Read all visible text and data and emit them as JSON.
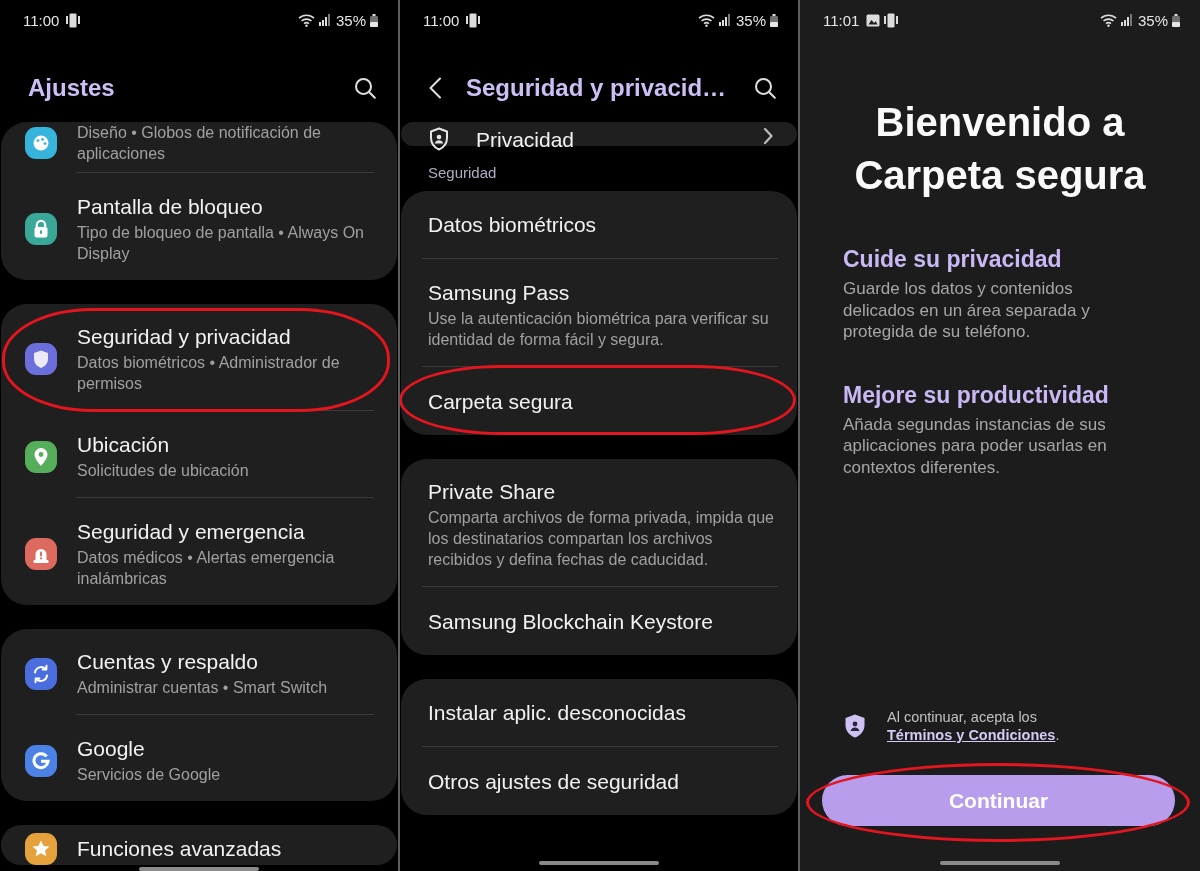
{
  "screens": [
    {
      "kind": "list",
      "status_bar": {
        "time": "11:00",
        "notifications": [
          {
            "kind": "phone"
          }
        ],
        "battery": "35%"
      },
      "header": {
        "title": "Ajustes"
      },
      "groups": [
        {
          "items": [
            {
              "kind": "palette",
              "color": "#37b4dc",
              "subtitle": "Diseño • Globos de notificación de aplicaciones",
              "highlighted": false
            },
            {
              "kind": "lock",
              "color": "#3aa898",
              "title": "Pantalla de bloqueo",
              "subtitle": "Tipo de bloqueo de pantalla • Always On Display",
              "highlighted": false
            }
          ]
        },
        {
          "items": [
            {
              "kind": "shield",
              "color": "#6b6fdc",
              "title": "Seguridad y privacidad",
              "subtitle": "Datos biométricos • Administrador de permisos",
              "highlighted": true
            },
            {
              "kind": "pin",
              "color": "#56ae5b",
              "title": "Ubicación",
              "subtitle": "Solicitudes de ubicación",
              "highlighted": false
            },
            {
              "kind": "siren",
              "color": "#dc6a5e",
              "title": "Seguridad y emergencia",
              "subtitle": "Datos médicos • Alertas emergencia inalámbricas",
              "highlighted": false
            }
          ]
        },
        {
          "items": [
            {
              "kind": "sync",
              "color": "#4a6ede",
              "title": "Cuentas y respaldo",
              "subtitle": "Administrar cuentas • Smart Switch",
              "highlighted": false
            },
            {
              "kind": "google",
              "color": "#4c82e6",
              "title": "Google",
              "subtitle": "Servicios de Google",
              "highlighted": false
            }
          ]
        },
        {
          "items": [
            {
              "kind": "star",
              "color": "#e5a23c",
              "title": "Funciones avanzadas",
              "highlighted": false
            }
          ]
        }
      ]
    },
    {
      "kind": "list",
      "status_bar": {
        "time": "11:00",
        "notifications": [
          {
            "kind": "phone"
          }
        ],
        "battery": "35%"
      },
      "header": {
        "title": "Seguridad y privacid…",
        "back": true
      },
      "groups": [
        {
          "items": [
            {
              "kind": "nav",
              "title": "Privacidad",
              "highlighted": false
            }
          ]
        },
        {
          "label": "Seguridad",
          "items": [
            {
              "kind": "text",
              "title": "Datos biométricos",
              "highlighted": false
            },
            {
              "kind": "text",
              "title": "Samsung Pass",
              "subtitle": "Use la autenticación biométrica para verificar su identidad de forma fácil y segura.",
              "highlighted": false
            },
            {
              "kind": "text",
              "title": "Carpeta segura",
              "highlighted": true
            }
          ]
        },
        {
          "items": [
            {
              "kind": "text",
              "title": "Private Share",
              "subtitle": "Comparta archivos de forma privada, impida que los destinatarios compartan los archivos recibidos y defina fechas de caducidad.",
              "highlighted": false
            },
            {
              "kind": "text",
              "title": "Samsung Blockchain Keystore",
              "highlighted": false
            }
          ]
        },
        {
          "items": [
            {
              "kind": "text",
              "title": "Instalar aplic. desconocidas",
              "highlighted": false
            },
            {
              "kind": "text",
              "title": "Otros ajustes de seguridad",
              "highlighted": false
            }
          ]
        }
      ]
    },
    {
      "kind": "welcome",
      "status_bar": {
        "time": "11:01",
        "notifications": [
          {
            "kind": "image"
          },
          {
            "kind": "phone"
          }
        ],
        "battery": "35%"
      },
      "title": "Bienvenido a Carpeta segura",
      "sections": [
        {
          "heading": "Cuide su privacidad",
          "body": "Guarde los datos y contenidos delicados en un área separada y protegida de su teléfono."
        },
        {
          "heading": "Mejore su productividad",
          "body": "Añada segundas instancias de sus aplicaciones para poder usarlas en contextos diferentes."
        }
      ],
      "terms": {
        "before": "Al continuar, acepta los",
        "link": "Términos y Condiciones",
        "after": "."
      },
      "button": {
        "label": "Continuar",
        "highlighted": true
      }
    }
  ]
}
